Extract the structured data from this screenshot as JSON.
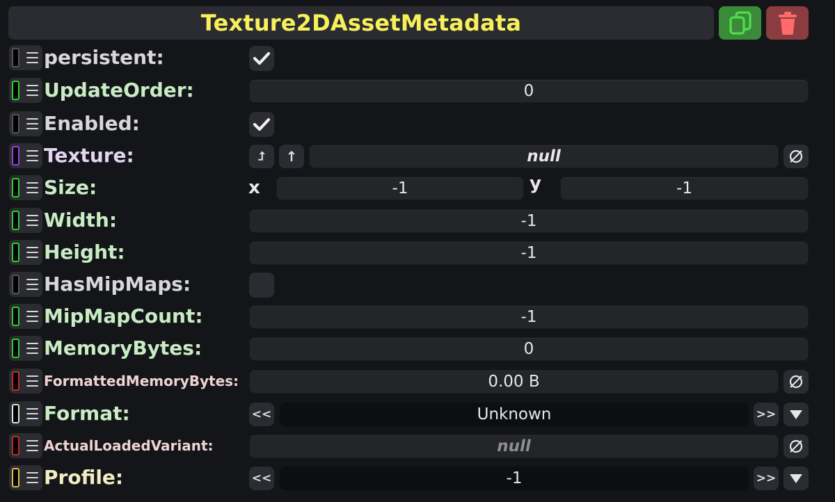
{
  "header": {
    "title": "Texture2DAssetMetadata"
  },
  "icons": {
    "duplicate": "duplicate-icon",
    "delete": "trash-icon",
    "menu": "menu-icon",
    "check": "check-icon",
    "null": "null-icon"
  },
  "colors": {
    "title": "#f7f05a",
    "duplicate_bg": "#3b8a3a",
    "delete_bg": "#8a3c40",
    "label_default": "#d8d8d8",
    "label_green": "#c8ecc3",
    "label_purple": "#e3d5f0",
    "label_red": "#f1d3d3",
    "label_yellow": "#f3edc4"
  },
  "rows": {
    "persistent": {
      "label": "persistent:",
      "checked": true
    },
    "update_order": {
      "label": "UpdateOrder:",
      "value": "0"
    },
    "enabled": {
      "label": "Enabled:",
      "checked": true
    },
    "texture": {
      "label": "Texture:",
      "value": "null",
      "btn1": "⮥",
      "btn2": "↑"
    },
    "size": {
      "label": "Size:",
      "x_label": "x",
      "x_value": "-1",
      "y_label": "y",
      "y_value": "-1"
    },
    "width": {
      "label": "Width:",
      "value": "-1"
    },
    "height": {
      "label": "Height:",
      "value": "-1"
    },
    "has_mipmaps": {
      "label": "HasMipMaps:",
      "checked": false
    },
    "mipmap_count": {
      "label": "MipMapCount:",
      "value": "-1"
    },
    "memory_bytes": {
      "label": "MemoryBytes:",
      "value": "0"
    },
    "formatted_memory_bytes": {
      "label": "FormattedMemoryBytes:",
      "value": "0.00 B"
    },
    "format": {
      "label": "Format:",
      "value": "Unknown",
      "prev": "<<",
      "next": ">>"
    },
    "actual_loaded_variant": {
      "label": "ActualLoadedVariant:",
      "value": "null"
    },
    "profile": {
      "label": "Profile:",
      "value": "-1",
      "prev": "<<",
      "next": ">>"
    }
  }
}
